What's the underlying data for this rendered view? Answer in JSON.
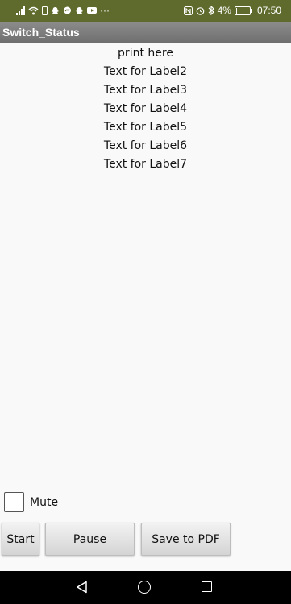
{
  "status_bar": {
    "battery": "4%",
    "time": "07:50",
    "left_icons": [
      "signal-icon",
      "wifi-icon",
      "sim-icon",
      "snapchat-icon",
      "messenger-icon",
      "snapchat-icon",
      "youtube-icon",
      "more-icon"
    ],
    "right_icons": [
      "nfc-icon",
      "alarm-icon",
      "bluetooth-icon",
      "battery-icon"
    ],
    "more_glyph": "···"
  },
  "app": {
    "title": "Switch_Status"
  },
  "labels": [
    "print here",
    "Text for Label2",
    "Text for Label3",
    "Text for Label4",
    "Text for Label5",
    "Text for Label6",
    "Text for Label7"
  ],
  "mute": {
    "label": "Mute",
    "checked": false
  },
  "buttons": {
    "start": "Start",
    "pause": "Pause",
    "save_pdf": "Save to PDF"
  },
  "colors": {
    "status_bar_bg": "#5f6b2d",
    "title_bar_bg": "#7d7d7d",
    "nav_bar_bg": "#000000"
  }
}
